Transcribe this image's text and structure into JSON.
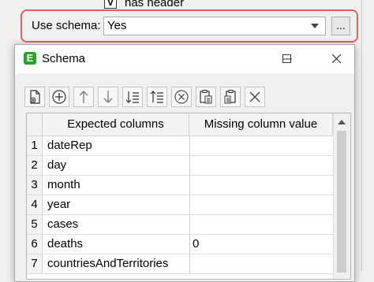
{
  "form": {
    "has_header_label": "has header",
    "has_header_check": "V",
    "use_schema_label": "Use schema:",
    "use_schema_value": "Yes",
    "browse_label": "..."
  },
  "dialog": {
    "app_icon_letter": "E",
    "title": "Schema",
    "toolbar_icons": [
      "new-file-icon",
      "add-icon",
      "move-up-icon",
      "move-down-icon",
      "sort-ascending-icon",
      "sort-descending-icon",
      "remove-icon",
      "paste-icon",
      "paste-alt-icon",
      "close-icon"
    ]
  },
  "table": {
    "columns": [
      "Expected columns",
      "Missing column value"
    ],
    "rows": [
      {
        "index": "1",
        "name": "dateRep",
        "missing": ""
      },
      {
        "index": "2",
        "name": "day",
        "missing": ""
      },
      {
        "index": "3",
        "name": "month",
        "missing": ""
      },
      {
        "index": "4",
        "name": "year",
        "missing": ""
      },
      {
        "index": "5",
        "name": "cases",
        "missing": ""
      },
      {
        "index": "6",
        "name": "deaths",
        "missing": "0"
      },
      {
        "index": "7",
        "name": "countriesAndTerritories",
        "missing": ""
      }
    ]
  },
  "colors": {
    "highlight_border": "#e06060",
    "app_icon": "#27a327"
  }
}
